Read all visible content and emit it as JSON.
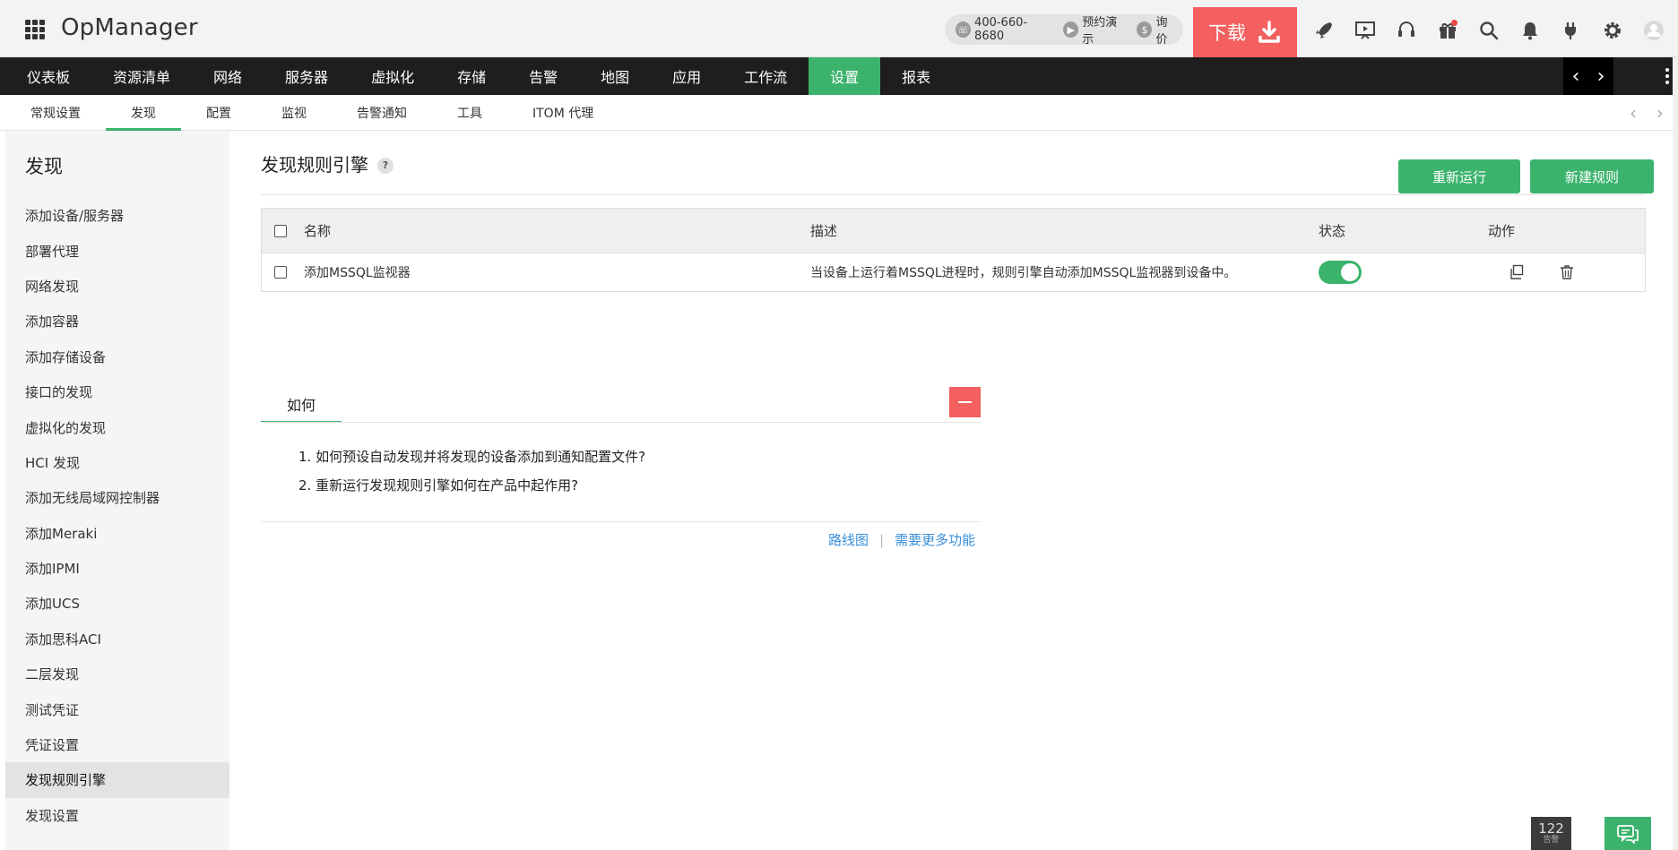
{
  "header": {
    "brand": "OpManager",
    "phone": "400-660-8680",
    "demo_label": "预约演示",
    "quote_label": "询价",
    "download_label": "下载",
    "icons": [
      "rocket-icon",
      "presentation-icon",
      "headset-icon",
      "gift-icon",
      "search-icon",
      "bell-icon",
      "plug-icon",
      "gear-icon",
      "user-avatar-icon"
    ]
  },
  "main_nav": {
    "items": [
      "仪表板",
      "资源清单",
      "网络",
      "服务器",
      "虚拟化",
      "存储",
      "告警",
      "地图",
      "应用",
      "工作流",
      "设置",
      "报表"
    ],
    "active": "设置"
  },
  "sub_nav": {
    "items": [
      "常规设置",
      "发现",
      "配置",
      "监视",
      "告警通知",
      "工具",
      "ITOM 代理"
    ],
    "active": "发现"
  },
  "sidebar": {
    "title": "发现",
    "items": [
      "添加设备/服务器",
      "部署代理",
      "网络发现",
      "添加容器",
      "添加存储设备",
      "接口的发现",
      "虚拟化的发现",
      "HCI 发现",
      "添加无线局域网控制器",
      "添加Meraki",
      "添加IPMI",
      "添加UCS",
      "添加思科ACI",
      "二层发现",
      "测试凭证",
      "凭证设置",
      "发现规则引擎",
      "发现设置"
    ],
    "active": "发现规则引擎"
  },
  "content": {
    "title": "发现规则引擎",
    "help_badge": "?",
    "rerun_label": "重新运行",
    "new_rule_label": "新建规则",
    "table": {
      "headers": {
        "name": "名称",
        "description": "描述",
        "status": "状态",
        "action": "动作"
      },
      "rows": [
        {
          "name": "添加MSSQL监视器",
          "description": "当设备上运行着MSSQL进程时，规则引擎自动添加MSSQL监视器到设备中。",
          "enabled": true
        }
      ]
    }
  },
  "howto": {
    "tab_label": "如何",
    "items": [
      "1. 如何预设自动发现并将发现的设备添加到通知配置文件?",
      "2. 重新运行发现规则引擎如何在产品中起作用?"
    ],
    "links": [
      "路线图",
      "需要更多功能"
    ],
    "link_separator": "|"
  },
  "widgets": {
    "alarm_count": "122",
    "alarm_label": "告警"
  },
  "colors": {
    "accent_green": "#3bb36c",
    "download_red": "#f45f5f",
    "nav_dark": "#1e1e1e",
    "link_blue": "#3a8fd9"
  }
}
